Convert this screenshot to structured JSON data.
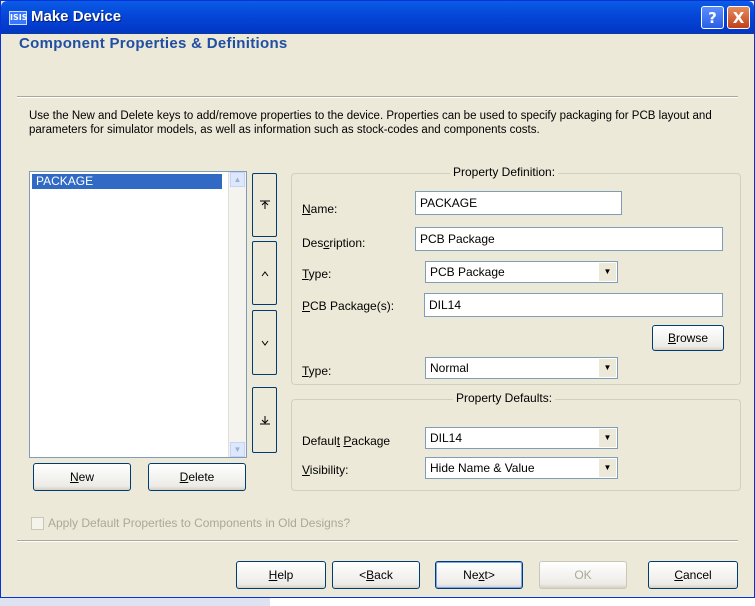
{
  "window": {
    "title": "Make Device",
    "app_icon": "ISIS",
    "help_label": "?",
    "close_label": "X"
  },
  "page": {
    "title": "Component Properties & Definitions",
    "description": "Use the New and Delete keys to add/remove properties to the device. Properties can be used to specify packaging for PCB layout and parameters for simulator models, as well as information such as stock-codes and components costs."
  },
  "property_list": {
    "items": [
      "PACKAGE"
    ],
    "selected": "PACKAGE"
  },
  "reorder_buttons": [
    "move-top-icon",
    "move-up-icon",
    "move-down-icon",
    "move-bottom-icon"
  ],
  "list_buttons": {
    "new": "New",
    "delete": "Delete"
  },
  "definition": {
    "legend": "Property Definition:",
    "name_label": "Name:",
    "name_value": "PACKAGE",
    "description_label": "Description:",
    "description_value": "PCB Package",
    "type_label": "Type:",
    "type_value": "PCB Package",
    "packages_label": "PCB Package(s):",
    "packages_value": "DIL14",
    "browse_label": "Browse",
    "type2_label": "Type:",
    "type2_value": "Normal"
  },
  "defaults": {
    "legend": "Property Defaults:",
    "package_label": "Default Package",
    "package_value": "DIL14",
    "visibility_label": "Visibility:",
    "visibility_value": "Hide Name & Value"
  },
  "apply_checkbox": {
    "label": "Apply Default Properties to Components in Old Designs?",
    "checked": false,
    "enabled": false
  },
  "footer": {
    "help": "Help",
    "back": "<Back",
    "next": "Next>",
    "ok": "OK",
    "cancel": "Cancel"
  },
  "colors": {
    "title_blue": "#0546d8",
    "heading_blue": "#1f4ea3",
    "selection": "#316ac5",
    "face": "#ece9d8"
  }
}
